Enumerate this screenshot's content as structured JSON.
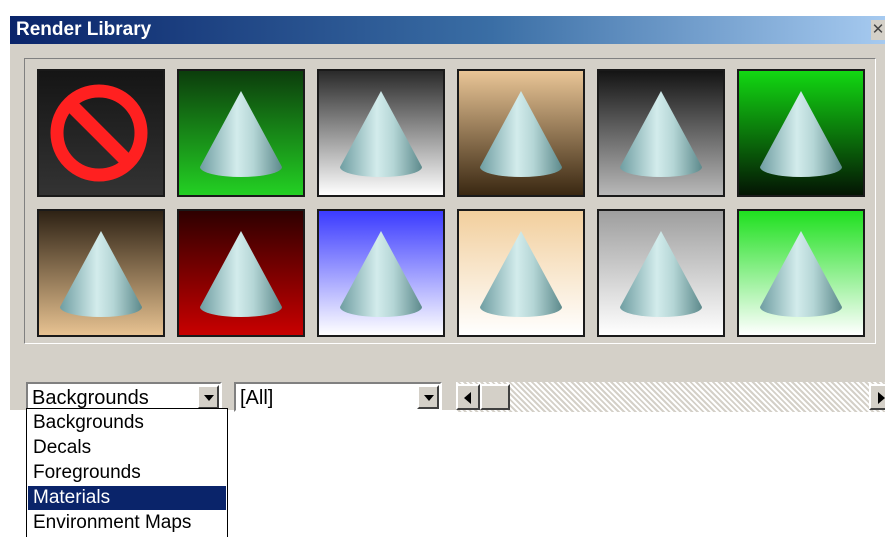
{
  "window": {
    "title": "Render Library",
    "close_glyph": "✕"
  },
  "library": {
    "rows": [
      [
        {
          "kind": "none",
          "bg": [
            "#151515",
            "#333333"
          ]
        },
        {
          "kind": "cone",
          "bg": [
            "#0c3d0c",
            "#23d023"
          ]
        },
        {
          "kind": "cone",
          "bg": [
            "#2a2a2a",
            "#ffffff"
          ]
        },
        {
          "kind": "cone",
          "bg": [
            "#e9c596",
            "#3a2812"
          ]
        },
        {
          "kind": "cone",
          "bg": [
            "#141414",
            "#b8b8b8"
          ]
        },
        {
          "kind": "cone",
          "bg": [
            "#12d812",
            "#041504"
          ]
        }
      ],
      [
        {
          "kind": "cone",
          "bg": [
            "#2e2214",
            "#e7c291"
          ]
        },
        {
          "kind": "cone",
          "bg": [
            "#2e0000",
            "#c80000"
          ]
        },
        {
          "kind": "cone",
          "bg": [
            "#3b3bff",
            "#ffffff"
          ]
        },
        {
          "kind": "cone",
          "bg": [
            "#f2cf9d",
            "#ffffff"
          ]
        },
        {
          "kind": "cone",
          "bg": [
            "#9e9e9e",
            "#ffffff"
          ]
        },
        {
          "kind": "cone",
          "bg": [
            "#1fe01f",
            "#ffffff"
          ]
        }
      ]
    ]
  },
  "category_combo": {
    "value": "Backgrounds",
    "icon": "chevron-down-icon"
  },
  "filter_combo": {
    "value": "[All]",
    "icon": "chevron-down-icon"
  },
  "scrollbar": {
    "position_fraction": 0.0
  },
  "dropdown": {
    "items": [
      {
        "label": "Backgrounds",
        "selected": false
      },
      {
        "label": "Decals",
        "selected": false
      },
      {
        "label": "Foregrounds",
        "selected": false
      },
      {
        "label": "Materials",
        "selected": true
      },
      {
        "label": "Environment Maps",
        "selected": false
      }
    ]
  }
}
